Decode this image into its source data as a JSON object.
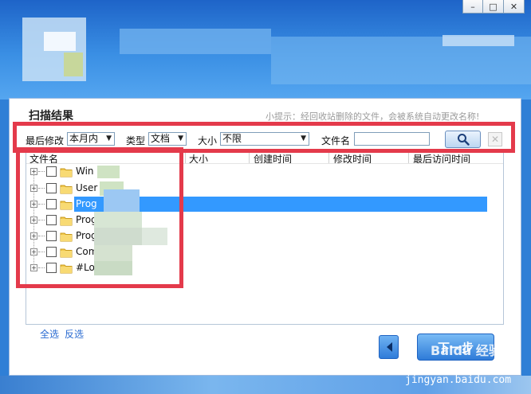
{
  "window": {
    "buttons": [
      {
        "name": "minimize",
        "glyph": "–"
      },
      {
        "name": "maximize",
        "glyph": "□"
      },
      {
        "name": "close",
        "glyph": "✕"
      }
    ]
  },
  "panel": {
    "title": "扫描结果",
    "tip": "小提示：经回收站删除的文件，会被系统自动更改名称!"
  },
  "filters": {
    "modified_label": "最后修改",
    "modified_value": "本月内",
    "type_label": "类型",
    "type_value": "文档",
    "size_label": "大小",
    "size_value": "不限",
    "filename_label": "文件名",
    "filename_value": "",
    "search_icon": "magnifier-icon",
    "clear_glyph": "✕"
  },
  "table": {
    "columns": [
      "文件名",
      "大小",
      "创建时间",
      "修改时间",
      "最后访问时间"
    ],
    "rows": [
      {
        "name": "Win",
        "selected": false
      },
      {
        "name": "User",
        "selected": false
      },
      {
        "name": "Prog",
        "selected": true
      },
      {
        "name": "Prog",
        "selected": false
      },
      {
        "name": "Prog",
        "selected": false
      },
      {
        "name": "Com",
        "selected": false
      },
      {
        "name": "#Lo",
        "selected": false
      }
    ]
  },
  "footer": {
    "select_all": "全选",
    "invert_select": "反选",
    "next_label": "下一步",
    "watermark_text": "Baidu 经验",
    "watermark_url": "jingyan.baidu.com"
  },
  "colors": {
    "accent": "#3399ff",
    "highlight_box": "#e43a4b",
    "link": "#2a6bd1"
  }
}
